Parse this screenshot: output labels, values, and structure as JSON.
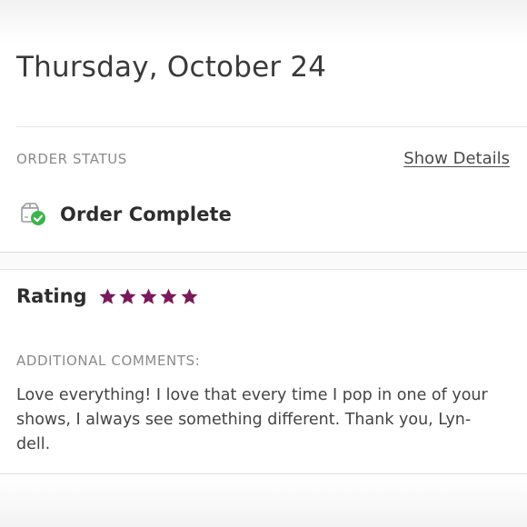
{
  "order": {
    "date": "Thursday, October 24"
  },
  "status": {
    "label": "ORDER STATUS",
    "details_link": "Show Details",
    "text": "Order Complete",
    "icon": "package-check-icon",
    "check_color": "#3bb44a"
  },
  "rating": {
    "label": "Rating",
    "stars": 5,
    "max_stars": 5,
    "star_color": "#7a1a5a"
  },
  "comments": {
    "label": "ADDITIONAL COMMENTS:",
    "lines": [
      "Love everything! I love that every time I pop in one of your",
      "shows, I always see something different. Thank you, Lyn-",
      "dell."
    ]
  }
}
